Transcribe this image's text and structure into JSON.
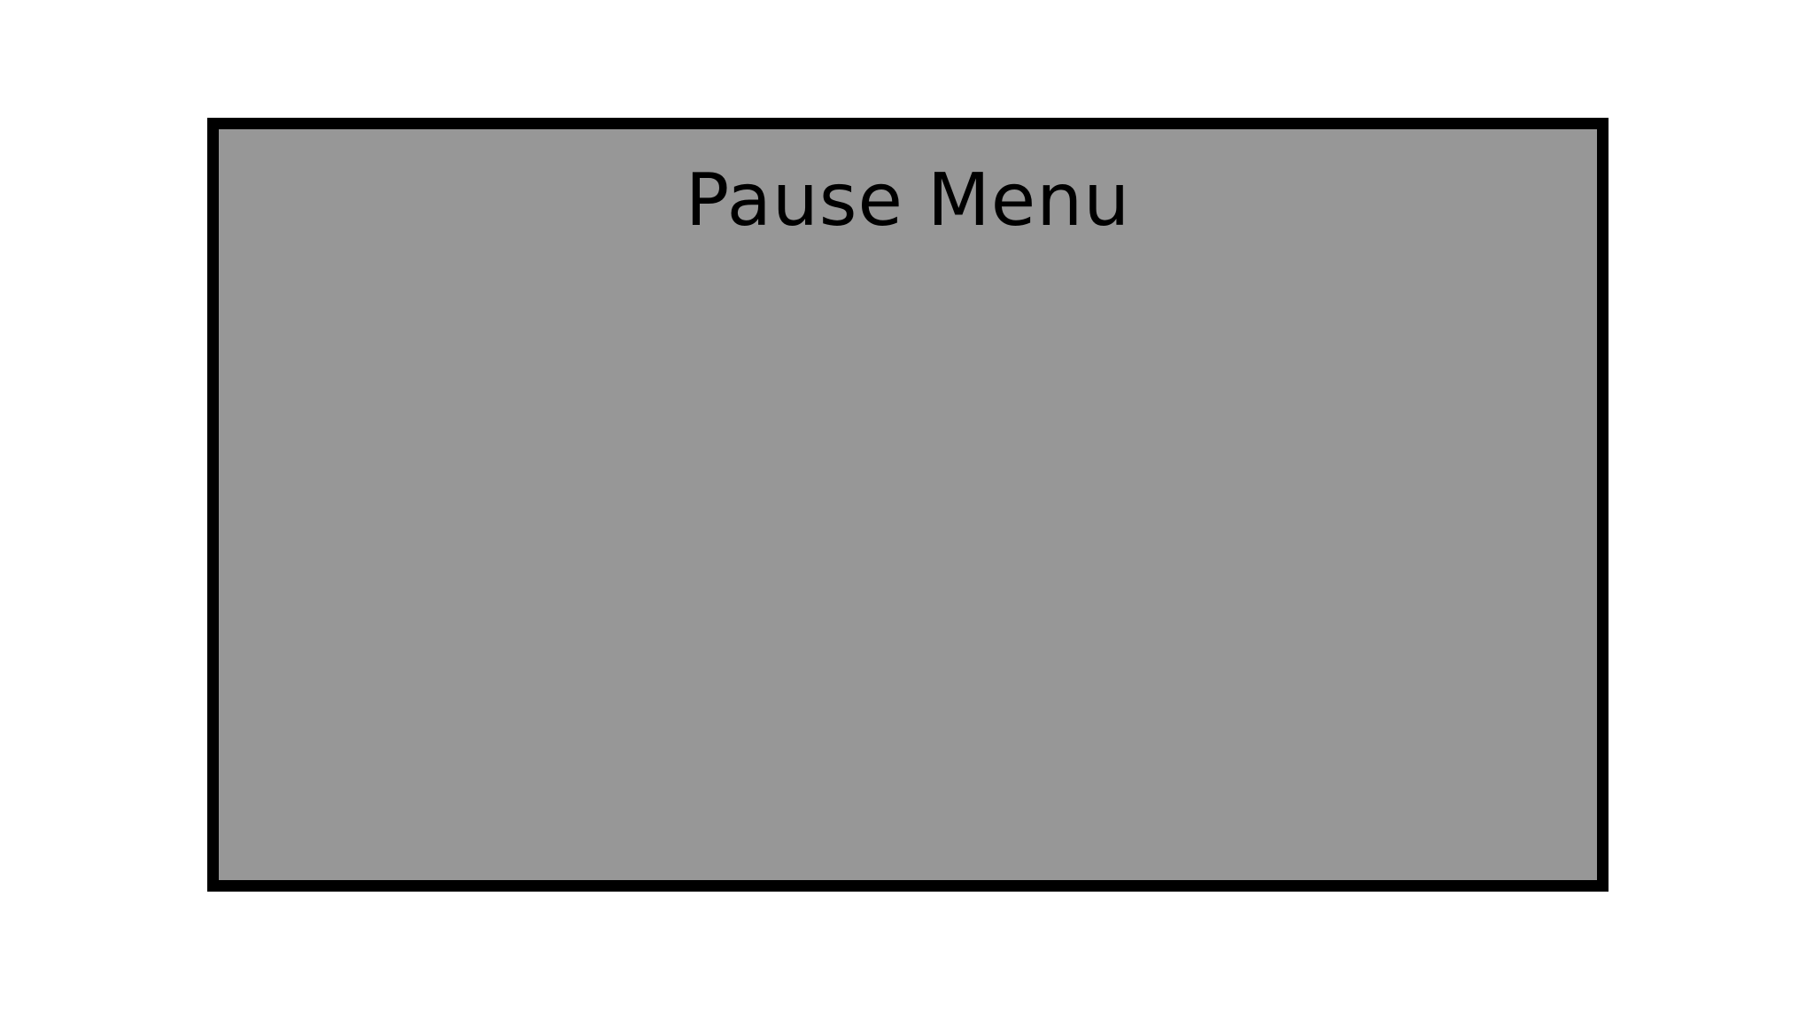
{
  "pause_menu": {
    "title": "Pause Menu"
  },
  "colors": {
    "background": "#ffffff",
    "panel_fill": "#979797",
    "panel_border": "#000000",
    "title_text": "#000000"
  }
}
